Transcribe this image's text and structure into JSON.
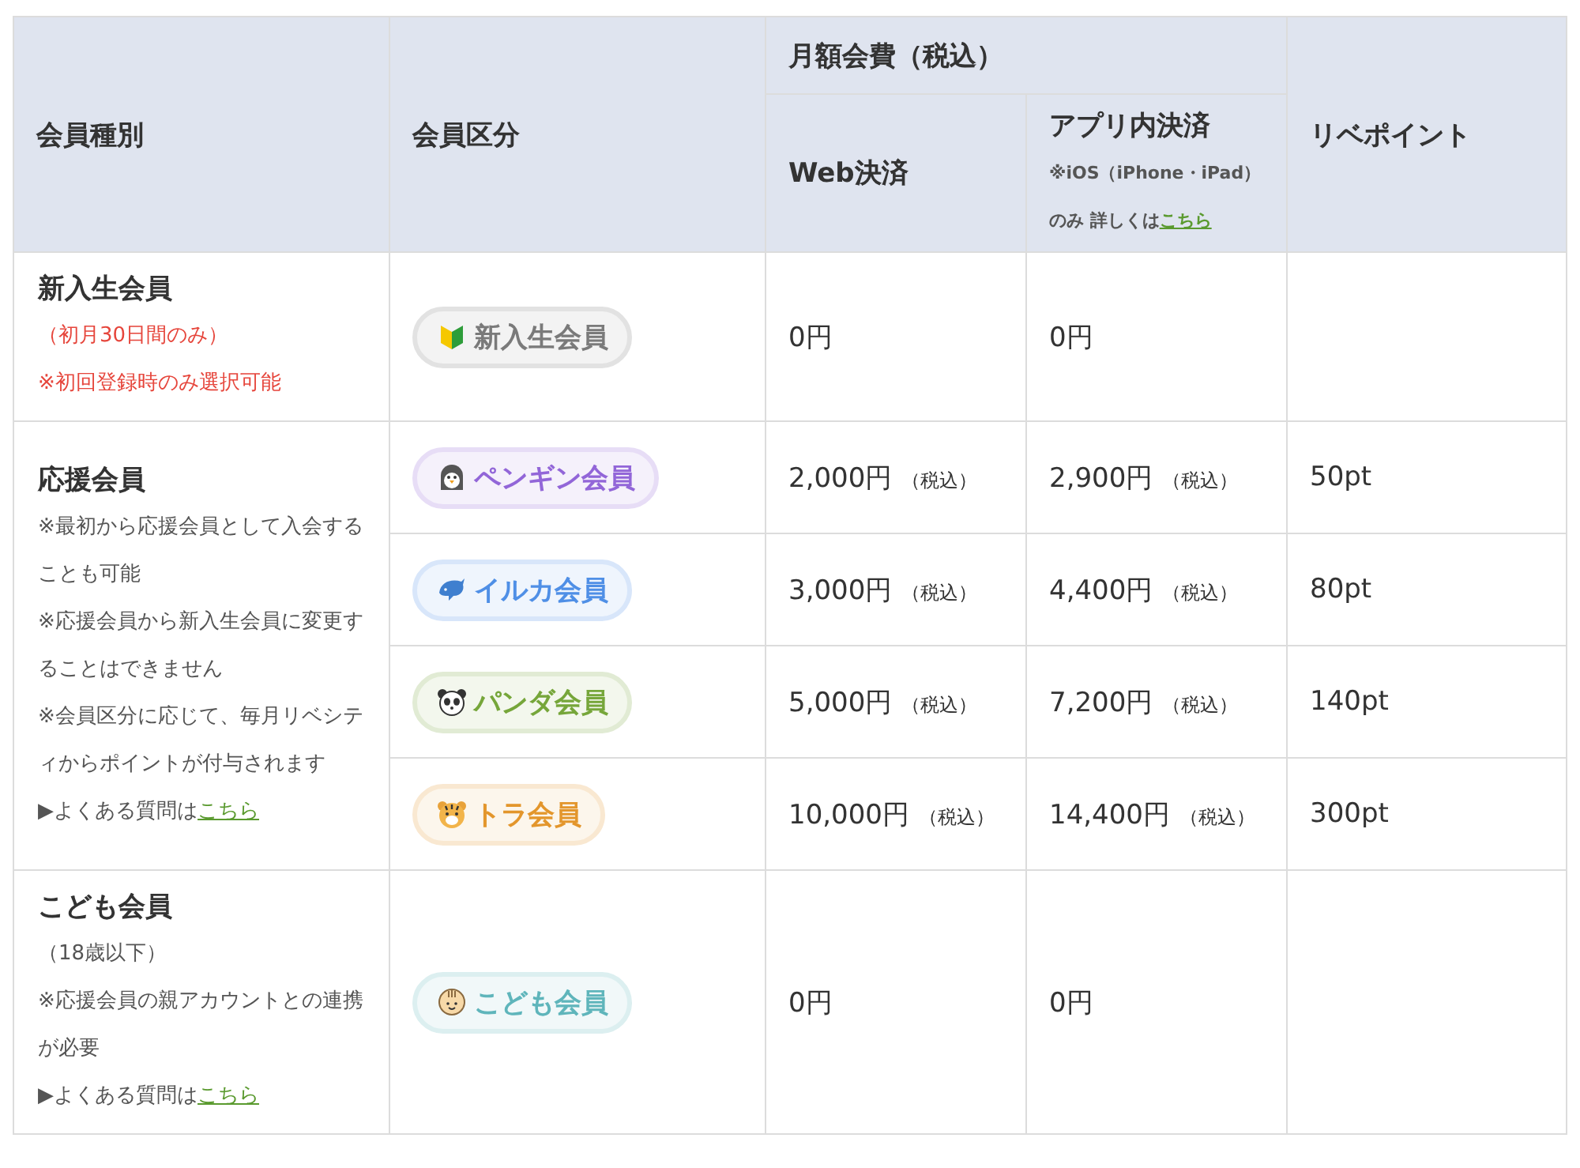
{
  "header": {
    "type_col": "会員種別",
    "class_col": "会員区分",
    "fee_group": "月額会費（税込）",
    "web_col": "Web決済",
    "app_col": "アプリ内決済",
    "app_note": "※iOS（iPhone・iPad）のみ 詳しくは",
    "app_link": "こちら",
    "points_col": "リベポイント"
  },
  "groups": [
    {
      "name": "新入生会員",
      "notes": [
        {
          "kind": "warning",
          "text": "（初月30日間のみ）"
        },
        {
          "kind": "warning",
          "text": "※初回登録時のみ選択可能"
        }
      ],
      "tiers": [
        {
          "kind": "beginner",
          "badge": "新入生会員",
          "color": "#7a7a7a",
          "web": "0円",
          "app": "0円"
        }
      ]
    },
    {
      "name": "応援会員",
      "notes": [
        {
          "kind": "note",
          "text": "※最初から応援会員として入会することも可能"
        },
        {
          "kind": "note",
          "text": "※応援会員から新入生会員に変更することはできません"
        },
        {
          "kind": "note",
          "text": "※会員区分に応じて、毎月リベシティからポイントが付与されます"
        },
        {
          "kind": "faq",
          "text": "▶よくある質問は",
          "link": "こちら"
        }
      ],
      "tiers": [
        {
          "kind": "penguin",
          "badge": "ペンギン会員",
          "color": "#9266d8",
          "web": "2,000円",
          "web_tax": "（税込）",
          "app": "2,900円",
          "app_tax": "（税込）",
          "points": "50pt"
        },
        {
          "kind": "dolphin",
          "badge": "イルカ会員",
          "color": "#4f8fe6",
          "web": "3,000円",
          "web_tax": "（税込）",
          "app": "4,400円",
          "app_tax": "（税込）",
          "points": "80pt"
        },
        {
          "kind": "panda",
          "badge": "パンダ会員",
          "color": "#76a63a",
          "web": "5,000円",
          "web_tax": "（税込）",
          "app": "7,200円",
          "app_tax": "（税込）",
          "points": "140pt"
        },
        {
          "kind": "tiger",
          "badge": "トラ会員",
          "color": "#e3962c",
          "web": "10,000円",
          "web_tax": "（税込）",
          "app": "14,400円",
          "app_tax": "（税込）",
          "points": "300pt"
        }
      ]
    },
    {
      "name": "こども会員",
      "notes": [
        {
          "kind": "note",
          "text": "（18歳以下）"
        },
        {
          "kind": "note",
          "text": "※応援会員の親アカウントとの連携が必要"
        },
        {
          "kind": "faq",
          "text": "▶よくある質問は",
          "link": "こちら"
        }
      ],
      "tiers": [
        {
          "kind": "child",
          "badge": "こども会員",
          "color": "#5fb5bb",
          "web": "0円",
          "app": "0円"
        }
      ]
    }
  ]
}
